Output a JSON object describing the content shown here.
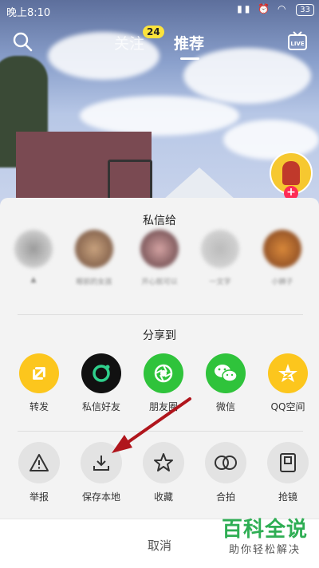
{
  "status_bar": {
    "time": "晚上8:10",
    "battery": "33"
  },
  "top_nav": {
    "tab_follow": "关注",
    "follow_badge": "24",
    "tab_recommended": "推荐",
    "live_icon": "LIVE"
  },
  "sheet": {
    "dm_title": "私信给",
    "dm_contacts": [
      "▲",
      "眼前的女孩",
      "开心就可以",
      "一文字",
      "小狮子"
    ],
    "share_title": "分享到",
    "share_items": [
      "转发",
      "私信好友",
      "朋友圈",
      "微信",
      "QQ空间"
    ],
    "action_items": [
      "举报",
      "保存本地",
      "收藏",
      "合拍",
      "抢镜"
    ],
    "cancel_label": "取消"
  },
  "watermark": {
    "main": "百科全说",
    "sub": "助你轻松解决"
  },
  "colors": {
    "yellow": "#fcc61d",
    "green": "#2fc33b",
    "dark": "#111111",
    "accent_red": "#b0151c"
  }
}
